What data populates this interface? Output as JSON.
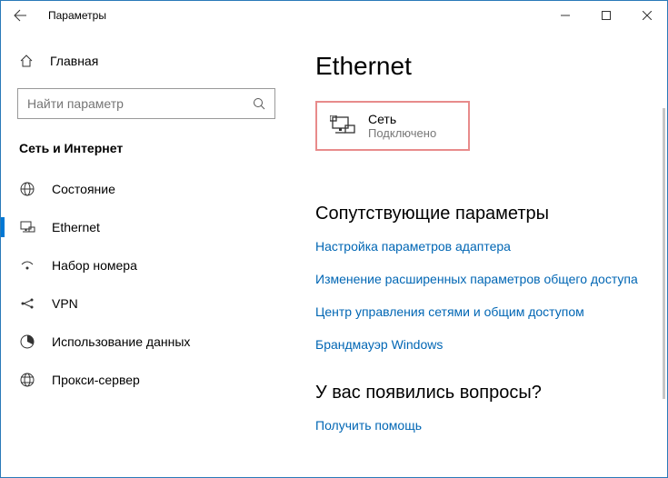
{
  "titlebar": {
    "title": "Параметры"
  },
  "sidebar": {
    "home": "Главная",
    "search_placeholder": "Найти параметр",
    "section": "Сеть и Интернет",
    "items": [
      {
        "label": "Состояние"
      },
      {
        "label": "Ethernet"
      },
      {
        "label": "Набор номера"
      },
      {
        "label": "VPN"
      },
      {
        "label": "Использование данных"
      },
      {
        "label": "Прокси-сервер"
      }
    ]
  },
  "main": {
    "heading": "Ethernet",
    "network": {
      "name": "Сеть",
      "status": "Подключено"
    },
    "related_heading": "Сопутствующие параметры",
    "links": [
      "Настройка параметров адаптера",
      "Изменение расширенных параметров общего доступа",
      "Центр управления сетями и общим доступом",
      "Брандмауэр Windows"
    ],
    "help_heading": "У вас появились вопросы?",
    "help_link": "Получить помощь"
  }
}
